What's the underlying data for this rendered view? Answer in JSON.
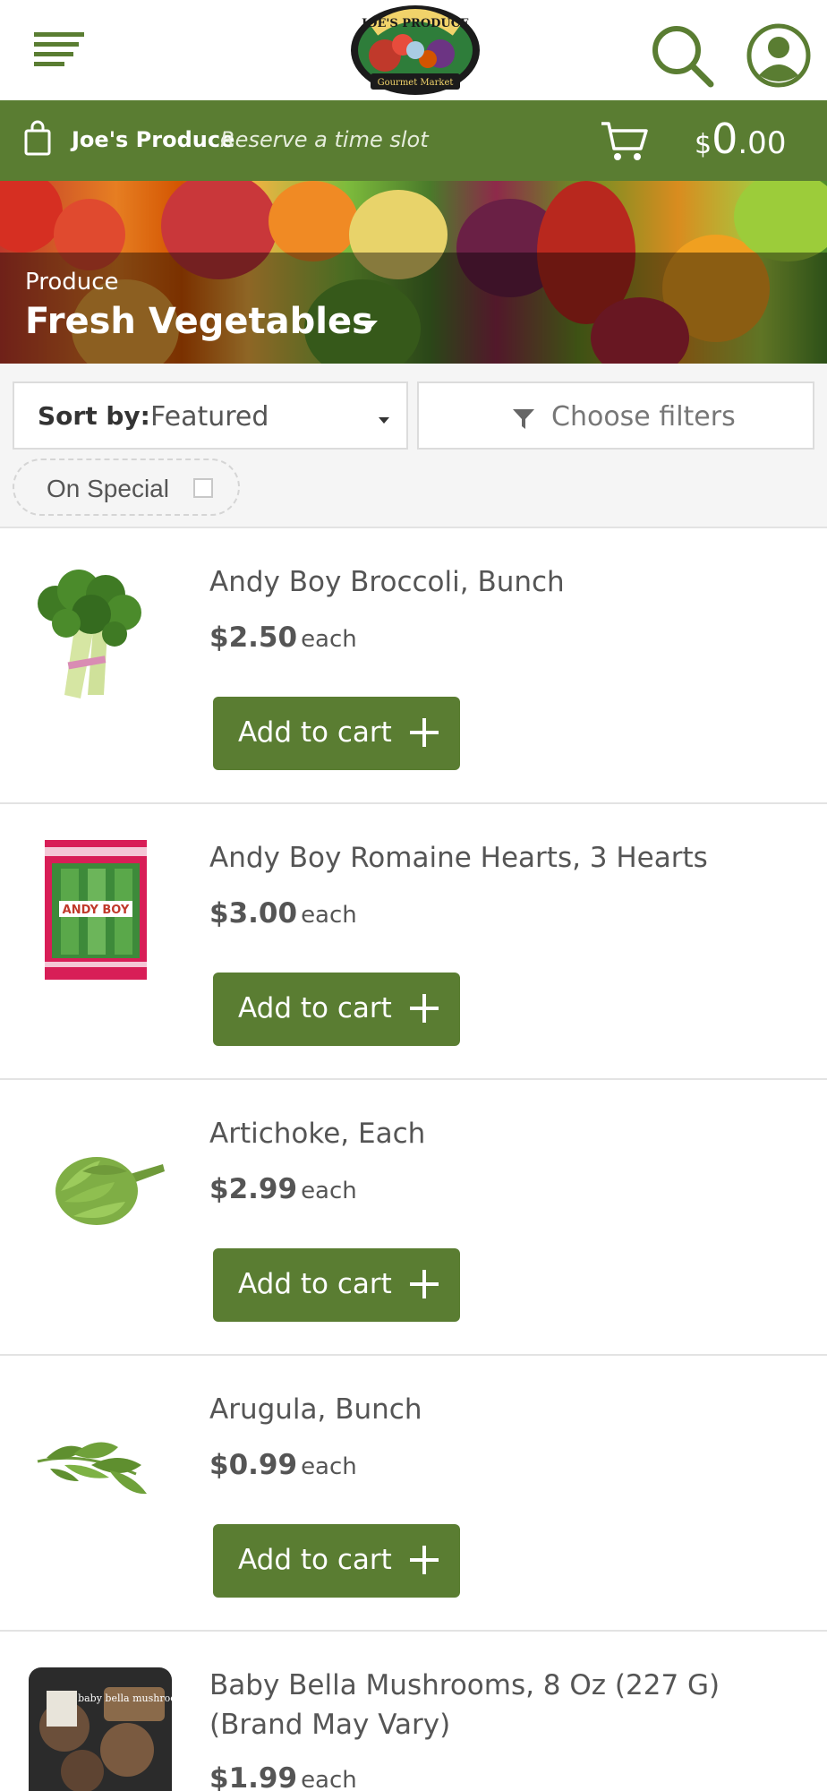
{
  "header": {
    "logo_text": "JOE'S PRODUCE",
    "logo_subtext": "Gourmet Market"
  },
  "store_bar": {
    "store_name": "Joe's Produce",
    "reserve_label": "Reserve a time slot",
    "cart_currency": "$",
    "cart_whole": "0",
    "cart_cents": ".00"
  },
  "banner": {
    "category": "Produce",
    "title": "Fresh Vegetables"
  },
  "filters": {
    "sort_label": "Sort by:",
    "sort_value": "Featured",
    "filter_label": "Choose filters",
    "special_label": "On Special"
  },
  "products": [
    {
      "name": "Andy Boy Broccoli, Bunch",
      "price": "$2.50",
      "unit": "each",
      "button": "Add to cart",
      "image": "broccoli"
    },
    {
      "name": "Andy Boy Romaine Hearts, 3 Hearts",
      "price": "$3.00",
      "unit": "each",
      "button": "Add to cart",
      "image": "romaine-package",
      "image_text": "ANDY BOY"
    },
    {
      "name": "Artichoke, Each",
      "price": "$2.99",
      "unit": "each",
      "button": "Add to cart",
      "image": "artichoke"
    },
    {
      "name": "Arugula, Bunch",
      "price": "$0.99",
      "unit": "each",
      "button": "Add to cart",
      "image": "arugula"
    },
    {
      "name": "Baby Bella Mushrooms, 8 Oz (227 G) (Brand May Vary)",
      "price": "$1.99",
      "unit": "each",
      "button": "Add to cart",
      "image": "mushroom-package",
      "image_text": "baby bella mushrooms"
    }
  ],
  "colors": {
    "brand_green": "#5a7d32",
    "text": "#555555"
  }
}
